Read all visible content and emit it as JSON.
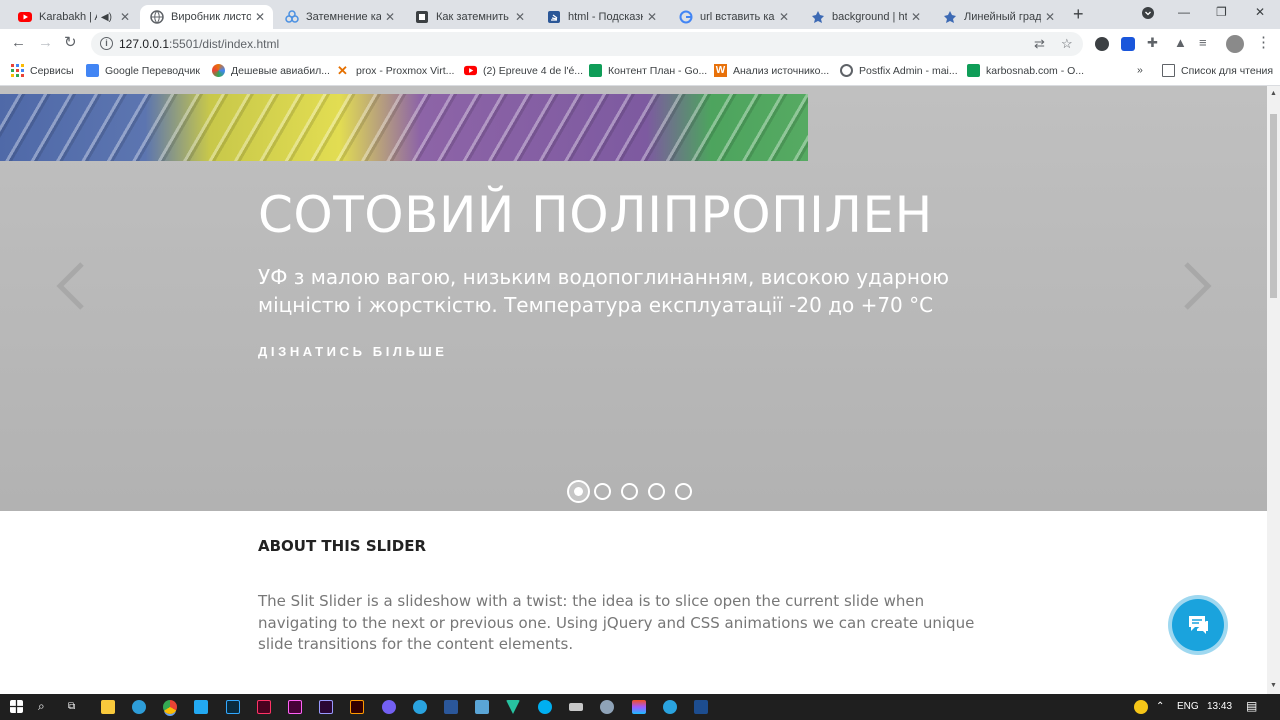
{
  "browser": {
    "tabs": [
      {
        "title": "Karabakh | Az",
        "icon": "youtube-icon",
        "color": "#ff0000"
      },
      {
        "title": "Виробник листо",
        "icon": "globe-icon",
        "color": "#5f6368"
      },
      {
        "title": "Затемнение карт",
        "icon": "codepen-icon",
        "color": "#4a90e2"
      },
      {
        "title": "Как затемнить из",
        "icon": "site-icon",
        "color": "#3c4043"
      },
      {
        "title": "html - Подсказки",
        "icon": "stackoverflow-icon",
        "color": "#2b5797"
      },
      {
        "title": "url вставить карт",
        "icon": "google-icon",
        "color": "#4285f4"
      },
      {
        "title": "background | htm",
        "icon": "mdn-icon",
        "color": "#3d6ab4"
      },
      {
        "title": "Линейный гради",
        "icon": "mdn-icon",
        "color": "#3d6ab4"
      }
    ],
    "url_host": "127.0.0.1",
    "url_path": ":5501/dist/index.html",
    "bookmarks": [
      {
        "label": "Сервисы",
        "icon": "apps-icon",
        "color": "#ea4335"
      },
      {
        "label": "Google Переводчик",
        "icon": "translate-icon",
        "color": "#4285f4"
      },
      {
        "label": "Дешевые авиабил...",
        "icon": "flight-icon",
        "color": "#e8710a"
      },
      {
        "label": "prox - Proxmox Virt...",
        "icon": "proxmox-icon",
        "color": "#e57000"
      },
      {
        "label": "(2) Epreuve 4 de l'é...",
        "icon": "youtube-icon",
        "color": "#ff0000"
      },
      {
        "label": "Контент План - Go...",
        "icon": "sheets-icon",
        "color": "#0f9d58"
      },
      {
        "label": "Анализ источнико...",
        "icon": "w-icon",
        "color": "#e8710a"
      },
      {
        "label": "Postfix Admin - mai...",
        "icon": "globe-icon",
        "color": "#5f6368"
      },
      {
        "label": "karbosnab.com - О...",
        "icon": "sheets-icon",
        "color": "#0f9d58"
      }
    ],
    "bookmarks_more": "»",
    "reading_list": "Список для чтения"
  },
  "slider": {
    "title": "СОТОВИЙ ПОЛІПРОПІЛЕН",
    "description": "УФ з малою вагою, низьким водопоглинанням, високою ударною міцністю і жорсткістю. Температура експлуатації -20 до +70 °С",
    "more_label": "ДІЗНАТИСЬ БІЛЬШЕ",
    "slide_count": 5,
    "active_slide": 1
  },
  "about": {
    "title": "ABOUT THIS SLIDER",
    "text": "The Slit Slider is a slideshow with a twist: the idea is to slice open the current slide when navigating to the next or previous one. Using jQuery and CSS animations we can create unique slide transitions for the content elements."
  },
  "taskbar": {
    "language": "ENG",
    "time": "13:43"
  }
}
